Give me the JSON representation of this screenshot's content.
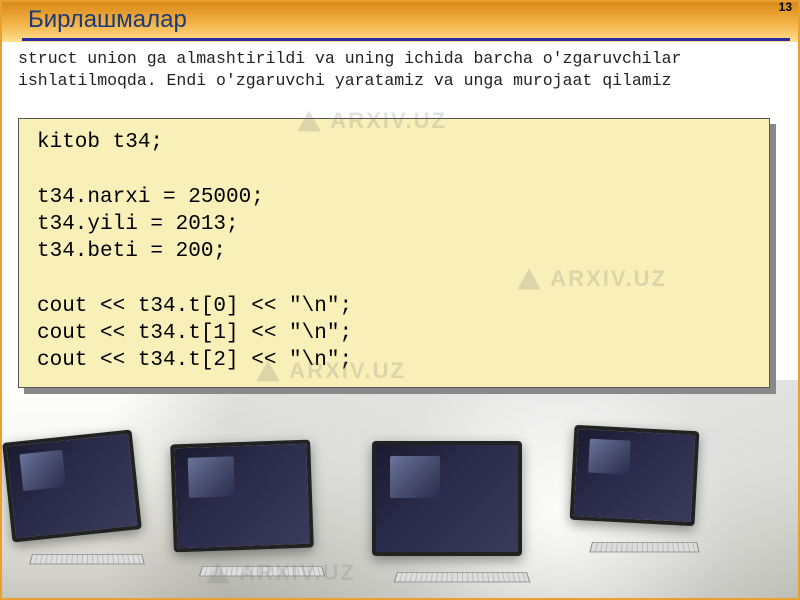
{
  "page_number": "13",
  "title": "Бирлашмалар",
  "description": "struct union ga almashtirildi va uning ichida barcha o'zgaruvchilar ishlatilmoqda. Endi o'zgaruvchi yaratamiz va unga murojaat qilamiz",
  "code": "kitob t34;\n\nt34.narxi = 25000;\nt34.yili = 2013;\nt34.beti = 200;\n\ncout << t34.t[0] << \"\\n\";\ncout << t34.t[1] << \"\\n\";\ncout << t34.t[2] << \"\\n\";",
  "watermark_text": "ARXIV.UZ"
}
